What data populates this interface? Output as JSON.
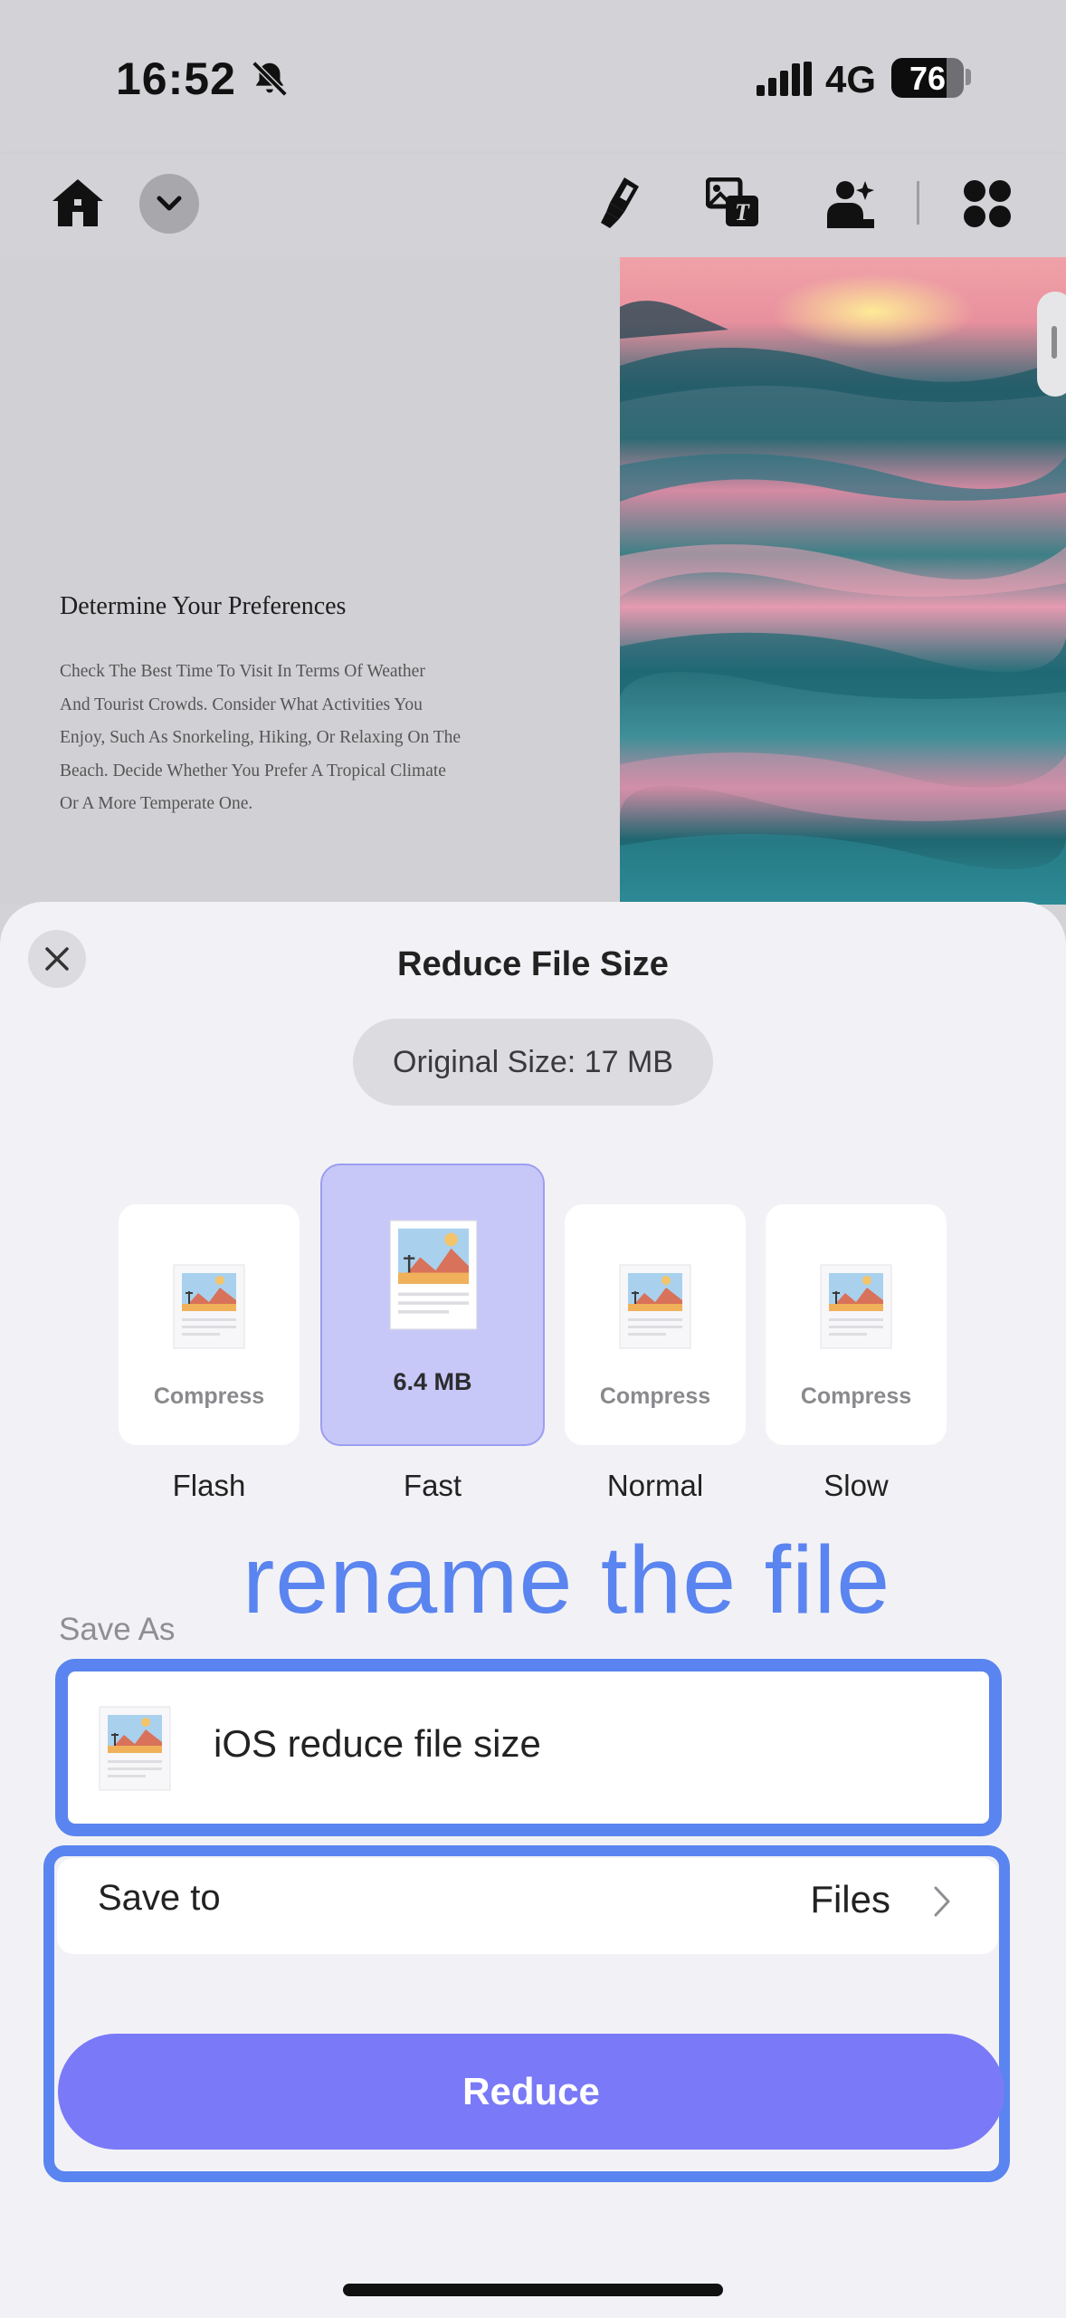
{
  "status_bar": {
    "time": "16:52",
    "network": "4G",
    "battery": "76",
    "battery_level_percent": 76,
    "icons": [
      "bell-slash-icon",
      "signal-icon",
      "battery-icon"
    ]
  },
  "toolbar": {
    "icons": [
      "home-icon",
      "chevron-down-icon",
      "highlighter-icon",
      "image-text-icon",
      "person-sparkle-icon",
      "apps-grid-icon"
    ]
  },
  "document": {
    "heading": "Determine Your Preferences",
    "body_lines": [
      "Check The Best Time To Visit In Terms Of Weather",
      "And Tourist Crowds. Consider What Activities You",
      "Enjoy, Such As Snorkeling, Hiking, Or Relaxing On The",
      "Beach. Decide Whether You Prefer A Tropical Climate",
      "Or A More Temperate One."
    ]
  },
  "sheet": {
    "title": "Reduce File Size",
    "original_size": "Original Size: 17 MB",
    "options": [
      {
        "sub": "Compress",
        "name": "Flash",
        "selected": false
      },
      {
        "sub": "6.4 MB",
        "name": "Fast",
        "selected": true
      },
      {
        "sub": "Compress",
        "name": "Normal",
        "selected": false
      },
      {
        "sub": "Compress",
        "name": "Slow",
        "selected": false
      }
    ],
    "annotation": "rename the file",
    "save_as_label": "Save As",
    "file_name": "iOS reduce file size",
    "save_to_label": "Save to",
    "save_to_value": "Files",
    "reduce_label": "Reduce"
  },
  "colors": {
    "accent": "#7a79f7",
    "selected_option": "#c7c8f7",
    "annotation": "#5a84ef"
  }
}
